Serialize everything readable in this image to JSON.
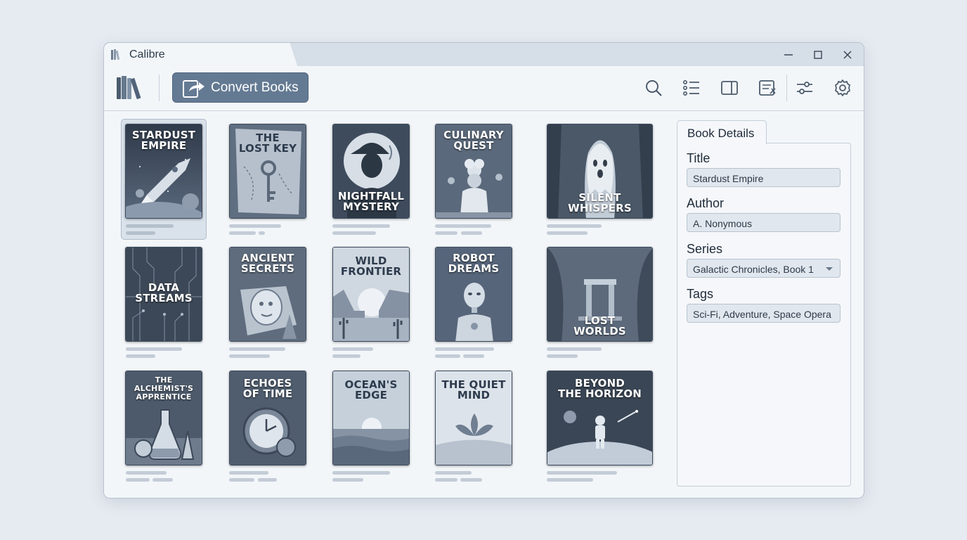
{
  "window": {
    "title": "Calibre"
  },
  "toolbar": {
    "convert_label": "Convert Books",
    "icons": [
      "library-icon",
      "convert-icon",
      "search-icon",
      "list-view-icon",
      "panel-icon",
      "edit-metadata-icon",
      "sliders-icon",
      "gear-icon"
    ]
  },
  "books": [
    {
      "title": "STARDUST\nEMPIRE"
    },
    {
      "title": "THE\nLOST KEY"
    },
    {
      "title": "NIGHTFALL\nMYSTERY"
    },
    {
      "title": "CULINARY\nQUEST"
    },
    {
      "title": "SILENT\nWHISPERS"
    },
    {
      "title": "DATA\nSTREAMS"
    },
    {
      "title": "ANCIENT\nSECRETS"
    },
    {
      "title": "WILD\nFRONTIER"
    },
    {
      "title": "ROBOT\nDREAMS"
    },
    {
      "title": "LOST\nWORLDS"
    },
    {
      "title": "THE\nALCHEMIST'S\nAPPRENTICE"
    },
    {
      "title": "ECHOES\nOF TIME"
    },
    {
      "title": "OCEAN'S\nEDGE"
    },
    {
      "title": "THE QUIET\nMIND"
    },
    {
      "title": "BEYOND\nTHE HORIZON"
    }
  ],
  "details": {
    "tab_label": "Book Details",
    "title_label": "Title",
    "title_value": "Stardust Empire",
    "author_label": "Author",
    "author_value": "A. Nonymous",
    "series_label": "Series",
    "series_value": "Galactic Chronicles, Book 1",
    "tags_label": "Tags",
    "tags_value": "Sci-Fi, Adventure, Space Opera"
  }
}
